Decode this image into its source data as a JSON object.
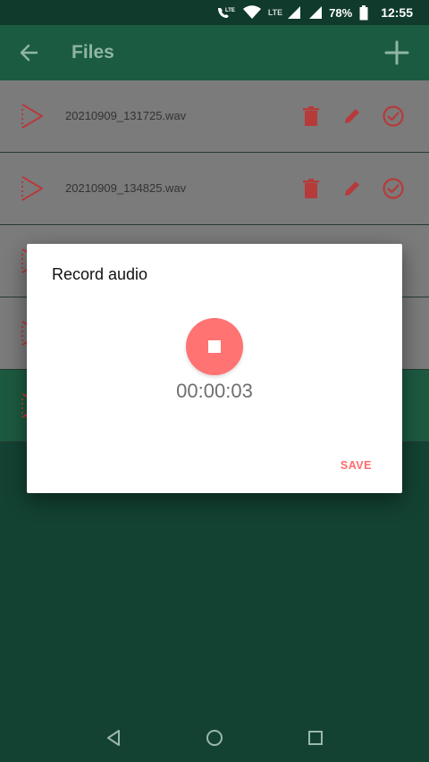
{
  "status_bar": {
    "network_label_1": "LTE",
    "network_label_2": "LTE",
    "battery": "78%",
    "time": "12:55"
  },
  "app_bar": {
    "title": "Files",
    "back_icon": "arrow-left-icon",
    "add_icon": "plus-icon"
  },
  "files": [
    {
      "name": "20210909_131725.wav"
    },
    {
      "name": "20210909_134825.wav"
    }
  ],
  "dialog": {
    "title": "Record audio",
    "timer": "00:00:03",
    "save_label": "SAVE"
  },
  "colors": {
    "accent": "#ff7373",
    "primary": "#1a5b41",
    "background": "#134232"
  }
}
